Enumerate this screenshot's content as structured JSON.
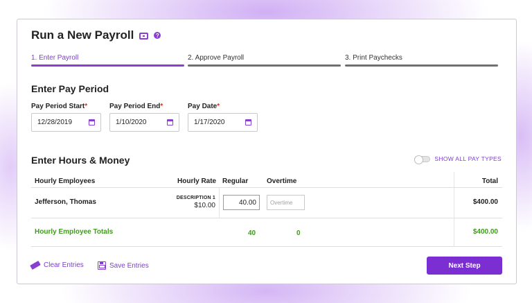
{
  "header": {
    "title": "Run a New Payroll",
    "video_icon": "video-icon",
    "help_icon": "help-icon",
    "help_glyph": "?"
  },
  "steps": [
    {
      "label": "1. Enter Payroll",
      "active": true
    },
    {
      "label": "2. Approve Payroll",
      "active": false
    },
    {
      "label": "3. Print Paychecks",
      "active": false
    }
  ],
  "pay_period": {
    "section_title": "Enter Pay Period",
    "start": {
      "label": "Pay Period Start",
      "required_mark": "*",
      "value": "12/28/2019"
    },
    "end": {
      "label": "Pay Period End",
      "required_mark": "*",
      "value": "1/10/2020"
    },
    "pay_date": {
      "label": "Pay Date",
      "required_mark": "*",
      "value": "1/17/2020"
    }
  },
  "hours": {
    "section_title": "Enter Hours & Money",
    "toggle_label": "SHOW ALL PAY TYPES",
    "toggle_on": false,
    "columns": {
      "employees": "Hourly Employees",
      "rate": "Hourly Rate",
      "regular": "Regular",
      "overtime": "Overtime",
      "total": "Total"
    },
    "rows": [
      {
        "name": "Jefferson, Thomas",
        "rate_description": "DESCRIPTION 1",
        "rate": "$10.00",
        "regular": "40.00",
        "overtime_placeholder": "Overtime",
        "total": "$400.00"
      }
    ],
    "totals": {
      "label": "Hourly Employee Totals",
      "regular": "40",
      "overtime": "0",
      "total": "$400.00"
    }
  },
  "footer": {
    "clear_label": "Clear Entries",
    "save_label": "Save Entries",
    "next_label": "Next Step"
  },
  "colors": {
    "accent": "#7b2fd3",
    "inactive_step": "#707070",
    "positive": "#3f9b1c"
  }
}
